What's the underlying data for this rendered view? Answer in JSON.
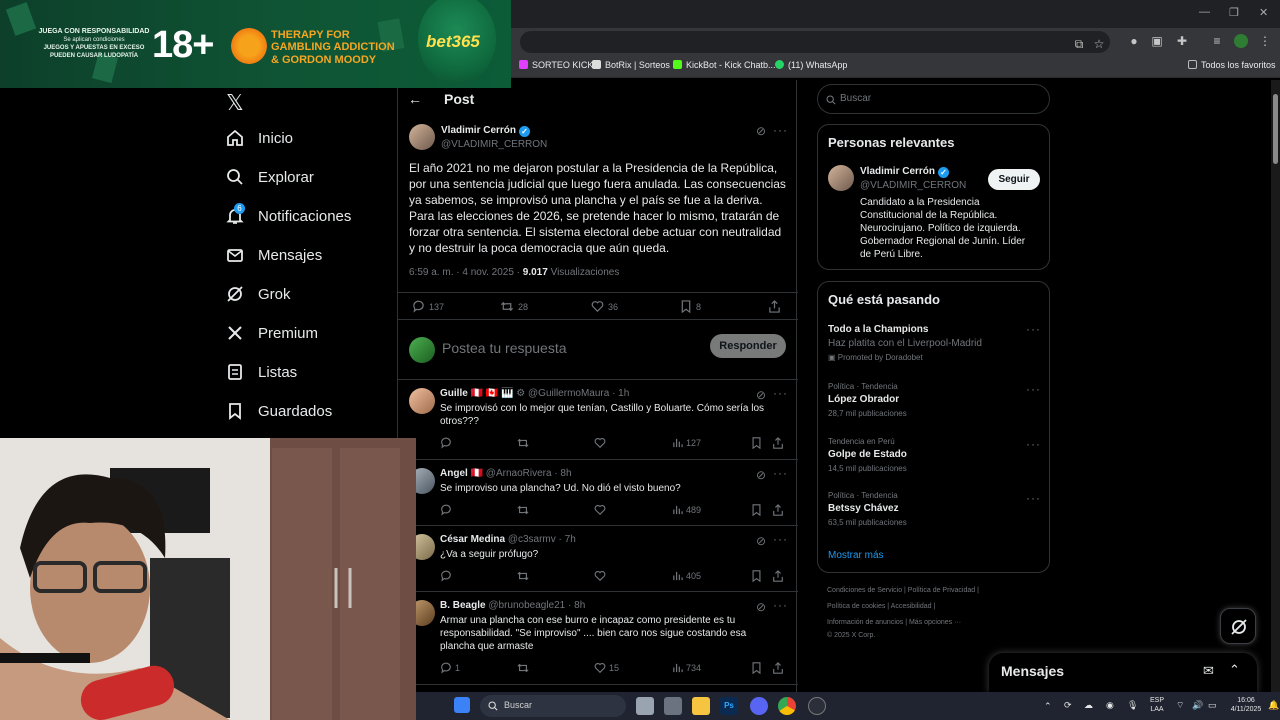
{
  "colors": {
    "accent": "#1d9bf0",
    "background": "#000000",
    "muted": "#71767b",
    "border": "#2f3336"
  },
  "ad": {
    "line1": "JUEGA CON RESPONSABILIDAD",
    "line2": "Se aplican condiciones",
    "line3": "JUEGOS Y APUESTAS EN EXCESO",
    "line4": "PUEDEN CAUSAR LUDOPATÍA",
    "age": "18+",
    "therapy": "THERAPY FOR",
    "gambling": "GAMBLING ADDICTION",
    "gordon": "& GORDON MOODY",
    "brand": "bet365"
  },
  "bookmarks": [
    {
      "label": "SORTEO KICK",
      "icon": "kick-icon",
      "color": "#e040fb"
    },
    {
      "label": "BotRix | Sorteos",
      "icon": "botrix-icon",
      "color": "#dddddd"
    },
    {
      "label": "KickBot - Kick Chatb...",
      "icon": "kickbot-icon",
      "color": "#53fc18"
    },
    {
      "label": "(11) WhatsApp",
      "icon": "whatsapp-icon",
      "color": "#25d366"
    }
  ],
  "all_bookmarks": "Todos los favoritos",
  "nav": {
    "items": [
      {
        "label": "Inicio",
        "icon": "home-icon"
      },
      {
        "label": "Explorar",
        "icon": "search-icon"
      },
      {
        "label": "Notificaciones",
        "icon": "bell-icon",
        "badge": "6"
      },
      {
        "label": "Mensajes",
        "icon": "mail-icon"
      },
      {
        "label": "Grok",
        "icon": "grok-icon"
      },
      {
        "label": "Premium",
        "icon": "x-premium-icon"
      },
      {
        "label": "Listas",
        "icon": "list-icon"
      },
      {
        "label": "Guardados",
        "icon": "bookmark-icon"
      }
    ]
  },
  "post": {
    "header": "Post",
    "author": "Vladimir Cerrón",
    "handle": "@VLADIMIR_CERRON",
    "verified_mark": "✓",
    "text_p1": "El año 2021 no me dejaron postular a la Presidencia de la República, por una sentencia judicial que luego fuera anulada. Las consecuencias ya sabemos, se improvisó una plancha y el país se fue a la deriva.",
    "text_p2": "Para las elecciones de 2026, se pretende hacer lo mismo, tratarán de forzar otra sentencia. El sistema electoral debe actuar con neutralidad y no destruir la poca democracia que aún queda.",
    "time": "6:59 a. m. · 4 nov. 2025 · ",
    "views": "9.017",
    "views_label": " Visualizaciones",
    "replies": "137",
    "reposts": "28",
    "likes": "36",
    "bookmarks": "8"
  },
  "reply_box": {
    "placeholder": "Postea tu respuesta",
    "button": "Responder"
  },
  "replies": [
    {
      "name": "Guille",
      "flags": "🇵🇪 🇨🇦 🎹 ⚙",
      "handle": "@GuillermoMaura · 1h",
      "text": "Se improvisó con lo mejor que tenían, Castillo y Boluarte. Cómo sería los otros???",
      "replies": "",
      "reposts": "",
      "likes": "",
      "views": "127"
    },
    {
      "name": "Angel",
      "flags": "🇵🇪",
      "handle": "@ArnaoRivera · 8h",
      "text": "Se improviso una plancha? Ud. No dió el visto bueno?",
      "replies": "",
      "reposts": "",
      "likes": "",
      "views": "489"
    },
    {
      "name": "César Medina",
      "flags": "",
      "handle": "@c3sarmv · 7h",
      "text": "¿Va a seguir prófugo?",
      "replies": "",
      "reposts": "",
      "likes": "",
      "views": "405"
    },
    {
      "name": "B. Beagle",
      "flags": "",
      "handle": "@brunobeagle21 · 8h",
      "text": "Armar una plancha con ese burro e incapaz como presidente es tu responsabilidad. \"Se improviso\" .... bien caro nos sigue costando esa plancha que armaste",
      "replies": "1",
      "reposts": "",
      "likes": "15",
      "views": "734"
    }
  ],
  "sidebar": {
    "search_placeholder": "Buscar",
    "relevant_title": "Personas relevantes",
    "person_name": "Vladimir Cerrón",
    "person_handle": "@VLADIMIR_CERRON",
    "follow": "Seguir",
    "bio": "Candidato a la Presidencia Constitucional de la República. Neurocirujano. Político de izquierda. Gobernador Regional de Junín. Líder de Perú Libre.",
    "trends_title": "Qué está pasando",
    "promo_title": "Todo a la Champions",
    "promo_sub": "Haz platita con el Liverpool-Madrid",
    "promo_by": "Promoted by Doradobet",
    "trends": [
      {
        "category": "Política · Tendencia",
        "name": "López Obrador",
        "count": "28,7 mil publicaciones"
      },
      {
        "category": "Tendencia en Perú",
        "name": "Golpe de Estado",
        "count": "14,5 mil publicaciones"
      },
      {
        "category": "Política · Tendencia",
        "name": "Betssy Chávez",
        "count": "63,5 mil publicaciones"
      }
    ],
    "show_more": "Mostrar más"
  },
  "footer": {
    "line1": "Condiciones de Servicio  |   Política de Privacidad  |",
    "line2": "Política de cookies  |   Accesibilidad  |",
    "line3": "Información de anuncios  |   Más opciones ···",
    "line4": "© 2025 X Corp."
  },
  "messages_drawer": {
    "title": "Mensajes"
  },
  "taskbar": {
    "search": "Buscar",
    "lang1": "ESP",
    "lang2": "LAA",
    "time": "16:06",
    "date": "4/11/2025"
  }
}
